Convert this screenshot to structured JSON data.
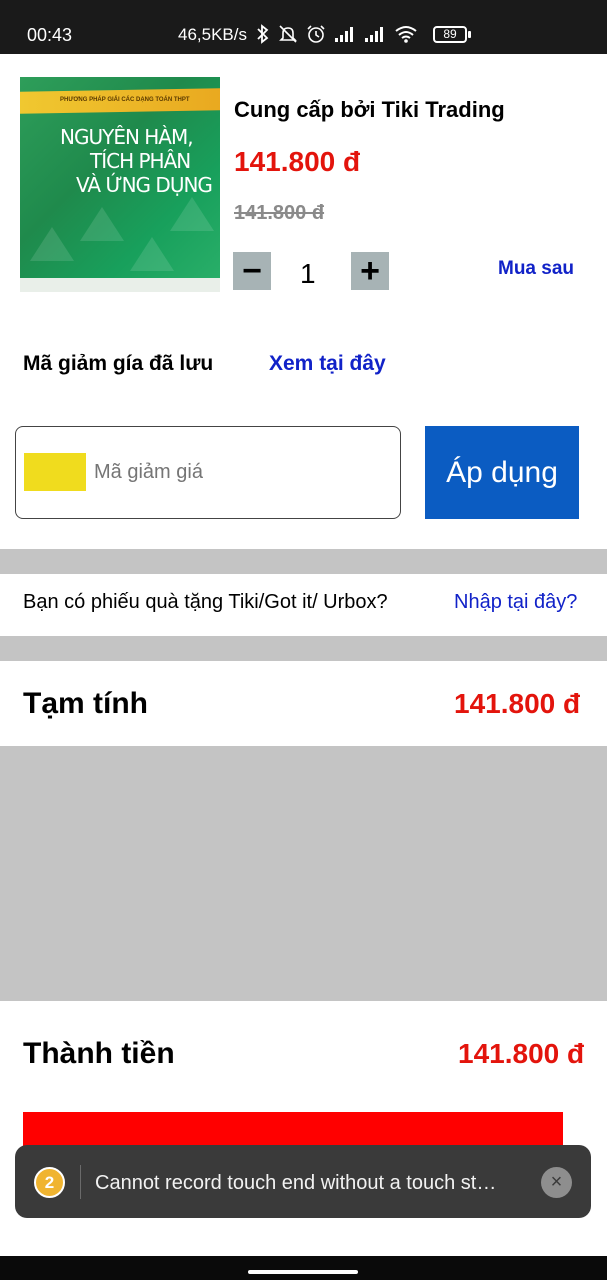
{
  "status_bar": {
    "time": "00:43",
    "network_speed": "46,5KB/s",
    "battery": "89",
    "icons": [
      "bluetooth-icon",
      "mute-icon",
      "alarm-icon",
      "signal-icon",
      "signal-icon",
      "wifi-icon",
      "battery-icon"
    ]
  },
  "product": {
    "cover": {
      "band_text": "PHƯƠNG PHÁP GIẢI CÁC DẠNG TOÁN THPT",
      "line1": "NGUYÊN HÀM,",
      "line2": "TÍCH PHÂN",
      "line3": "VÀ ỨNG DỤNG"
    },
    "provider": "Cung cấp bởi Tiki Trading",
    "price": "141.800 đ",
    "old_price": "141.800 đ",
    "quantity": "1",
    "minus_label": "−",
    "plus_label": "+",
    "buy_later": "Mua sau"
  },
  "coupon": {
    "saved_label": "Mã giảm gía đã lưu",
    "saved_link": "Xem tại đây",
    "placeholder": "Mã giảm giá",
    "apply_label": "Áp dụng"
  },
  "gift": {
    "text": "Bạn có phiếu quà tặng Tiki/Got it/ Urbox?",
    "link": "Nhập tại đây?"
  },
  "summary": {
    "subtotal_label": "Tạm tính",
    "subtotal_value": "141.800 đ",
    "total_label": "Thành tiền",
    "total_value": "141.800 đ"
  },
  "toast": {
    "count": "2",
    "message": "Cannot record touch end without a touch st…",
    "close": "×"
  },
  "colors": {
    "price_red": "#e3140c",
    "link_blue": "#1122c8",
    "apply_blue": "#0b5cc2",
    "separator_gray": "#c4c4c4",
    "checkout_red": "#ff0000"
  }
}
